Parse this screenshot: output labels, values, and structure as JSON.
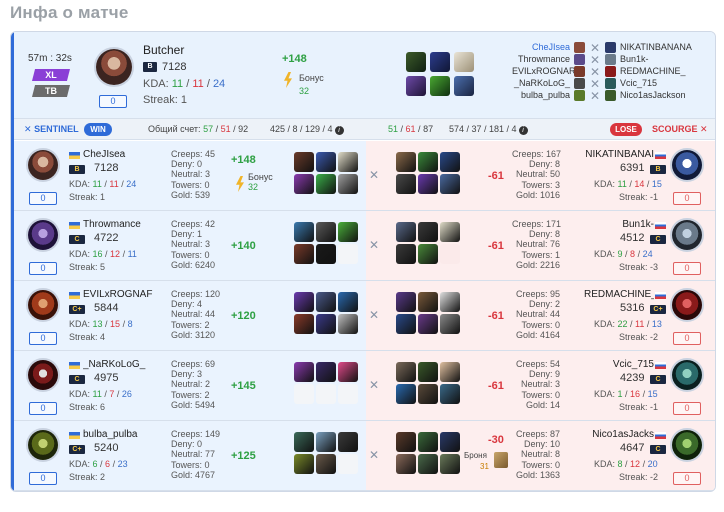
{
  "page_title": "Инфа о матче",
  "header": {
    "duration": "57m : 32s",
    "mode_badge": "XL",
    "type_badge": "TB",
    "mvp": {
      "name": "Butcher",
      "rank": "B",
      "mmr": "7128",
      "kda_label": "KDA:",
      "k": "11",
      "d": "11",
      "a": "24",
      "streak": "Streak: 1",
      "score": "0",
      "delta": "+148",
      "bonus_label": "Бонус",
      "bonus_value": "32"
    },
    "sentinel_names": [
      "CheJIsea",
      "Throwmance",
      "EVILxROGNAR",
      "_NaRKoLoG_",
      "bulba_pulba"
    ],
    "scourge_names": [
      "NIKATINBANANA",
      "Bun1k-",
      "REDMACHINE_",
      "Vcic_715",
      "Nico1asJackson"
    ]
  },
  "score_bar": {
    "sentinel_label": "SENTINEL",
    "win_label": "WIN",
    "total_label": "Общий счет:",
    "sentinel_k": "57",
    "sentinel_d": "51",
    "sentinel_a": "92",
    "sentinel_extra": "425 / 8 / 129 / 4",
    "scourge_k": "51",
    "scourge_d": "61",
    "scourge_a": "87",
    "scourge_extra": "574 / 37 / 181 / 4",
    "lose_label": "LOSE",
    "scourge_label": "SCOURGE"
  },
  "rows": [
    {
      "left": {
        "name": "CheJIsea",
        "rank": "B",
        "mmr": "7128",
        "k": "11",
        "d": "11",
        "a": "24",
        "streak": "Streak: 1",
        "score": "0",
        "creeps": "Creeps: 45",
        "deny": "Deny: 0",
        "neutral": "Neutral: 3",
        "towers": "Towers: 0",
        "gold": "Gold: 539",
        "delta": "+148",
        "bonus_label": "Бонус",
        "bonus_value": "32"
      },
      "right": {
        "name": "NIKATINBANAI",
        "rank": "B",
        "mmr": "6391",
        "k": "11",
        "d": "14",
        "a": "15",
        "streak": "Streak: -1",
        "score": "0",
        "creeps": "Creeps: 167",
        "deny": "Deny: 8",
        "neutral": "Neutral: 50",
        "towers": "Towers: 3",
        "gold": "Gold: 1016",
        "delta": "-61"
      }
    },
    {
      "left": {
        "name": "Throwmance",
        "rank": "C",
        "mmr": "4722",
        "k": "16",
        "d": "12",
        "a": "11",
        "streak": "Streak: 5",
        "score": "0",
        "creeps": "Creeps: 42",
        "deny": "Deny: 1",
        "neutral": "Neutral: 3",
        "towers": "Towers: 0",
        "gold": "Gold: 6240",
        "delta": "+140"
      },
      "right": {
        "name": "Bun1k-",
        "rank": "C",
        "mmr": "4512",
        "k": "9",
        "d": "8",
        "a": "24",
        "streak": "Streak: -3",
        "score": "0",
        "creeps": "Creeps: 171",
        "deny": "Deny: 8",
        "neutral": "Neutral: 76",
        "towers": "Towers: 1",
        "gold": "Gold: 2216",
        "delta": "-61"
      }
    },
    {
      "left": {
        "name": "EVILxROGNAF",
        "rank": "C+",
        "mmr": "5844",
        "k": "13",
        "d": "15",
        "a": "8",
        "streak": "Streak: 4",
        "score": "0",
        "creeps": "Creeps: 120",
        "deny": "Deny: 4",
        "neutral": "Neutral: 44",
        "towers": "Towers: 2",
        "gold": "Gold: 3120",
        "delta": "+120"
      },
      "right": {
        "name": "REDMACHINE_",
        "rank": "C+",
        "mmr": "5316",
        "k": "22",
        "d": "11",
        "a": "13",
        "streak": "Streak: -2",
        "score": "0",
        "creeps": "Creeps: 95",
        "deny": "Deny: 2",
        "neutral": "Neutral: 44",
        "towers": "Towers: 0",
        "gold": "Gold: 4164",
        "delta": "-61"
      }
    },
    {
      "left": {
        "name": "_NaRKoLoG_",
        "rank": "C",
        "mmr": "4975",
        "k": "11",
        "d": "7",
        "a": "26",
        "streak": "Streak: 6",
        "score": "0",
        "creeps": "Creeps: 69",
        "deny": "Deny: 3",
        "neutral": "Neutral: 2",
        "towers": "Towers: 2",
        "gold": "Gold: 5494",
        "delta": "+145"
      },
      "right": {
        "name": "Vcic_715",
        "rank": "C",
        "mmr": "4239",
        "k": "1",
        "d": "16",
        "a": "15",
        "streak": "Streak: -1",
        "score": "0",
        "creeps": "Creeps: 54",
        "deny": "Deny: 9",
        "neutral": "Neutral: 3",
        "towers": "Towers: 0",
        "gold": "Gold: 14",
        "delta": "-61"
      }
    },
    {
      "left": {
        "name": "bulba_pulba",
        "rank": "C+",
        "mmr": "5240",
        "k": "6",
        "d": "6",
        "a": "23",
        "streak": "Streak: 2",
        "score": "0",
        "creeps": "Creeps: 149",
        "deny": "Deny: 0",
        "neutral": "Neutral: 77",
        "towers": "Towers: 0",
        "gold": "Gold: 4767",
        "delta": "+125"
      },
      "right": {
        "name": "Nico1asJacks",
        "rank": "C",
        "mmr": "4647",
        "k": "8",
        "d": "12",
        "a": "20",
        "streak": "Streak: -2",
        "score": "0",
        "creeps": "Creeps: 87",
        "deny": "Deny: 10",
        "neutral": "Neutral: 8",
        "towers": "Towers: 0",
        "gold": "Gold: 1363",
        "delta": "-30",
        "armor_label": "Броня",
        "armor_value": "31"
      }
    }
  ],
  "colors": {
    "sentinel": "#2f6bd8",
    "scourge": "#d9363e",
    "positive": "#2ea043",
    "negative": "#d9363e"
  }
}
